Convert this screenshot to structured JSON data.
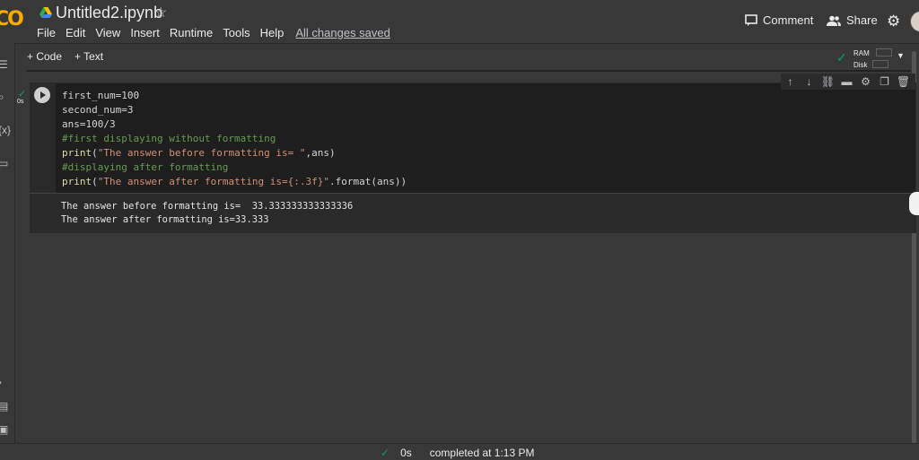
{
  "header": {
    "logo": "CO",
    "filename": "Untitled2.ipynb",
    "menu": [
      "File",
      "Edit",
      "View",
      "Insert",
      "Runtime",
      "Tools",
      "Help"
    ],
    "save_status": "All changes saved",
    "comment_label": "Comment",
    "share_label": "Share"
  },
  "toolbar": {
    "add_code_label": "+ Code",
    "add_text_label": "+ Text",
    "ram_label": "RAM",
    "disk_label": "Disk"
  },
  "cell": {
    "exec_time": "0s",
    "code_lines": [
      "first_num=100",
      "second_num=3",
      "ans=100/3",
      "#first displaying without formatting",
      "print(\"The answer before formatting is= \",ans)",
      "#displaying after formatting",
      "print(\"The answer after formatting is={:.3f}\".format(ans))"
    ],
    "output_lines": [
      "The answer before formatting is=  33.333333333333336",
      "The answer after formatting is=33.333"
    ]
  },
  "status": {
    "time": "0s",
    "text": "completed at 1:13 PM"
  },
  "colors": {
    "background": "#383838",
    "code_bg": "#1e1e1e",
    "comment": "#6a9955",
    "string": "#ce9178",
    "function": "#dcdcaa",
    "success": "#0f9d58"
  }
}
